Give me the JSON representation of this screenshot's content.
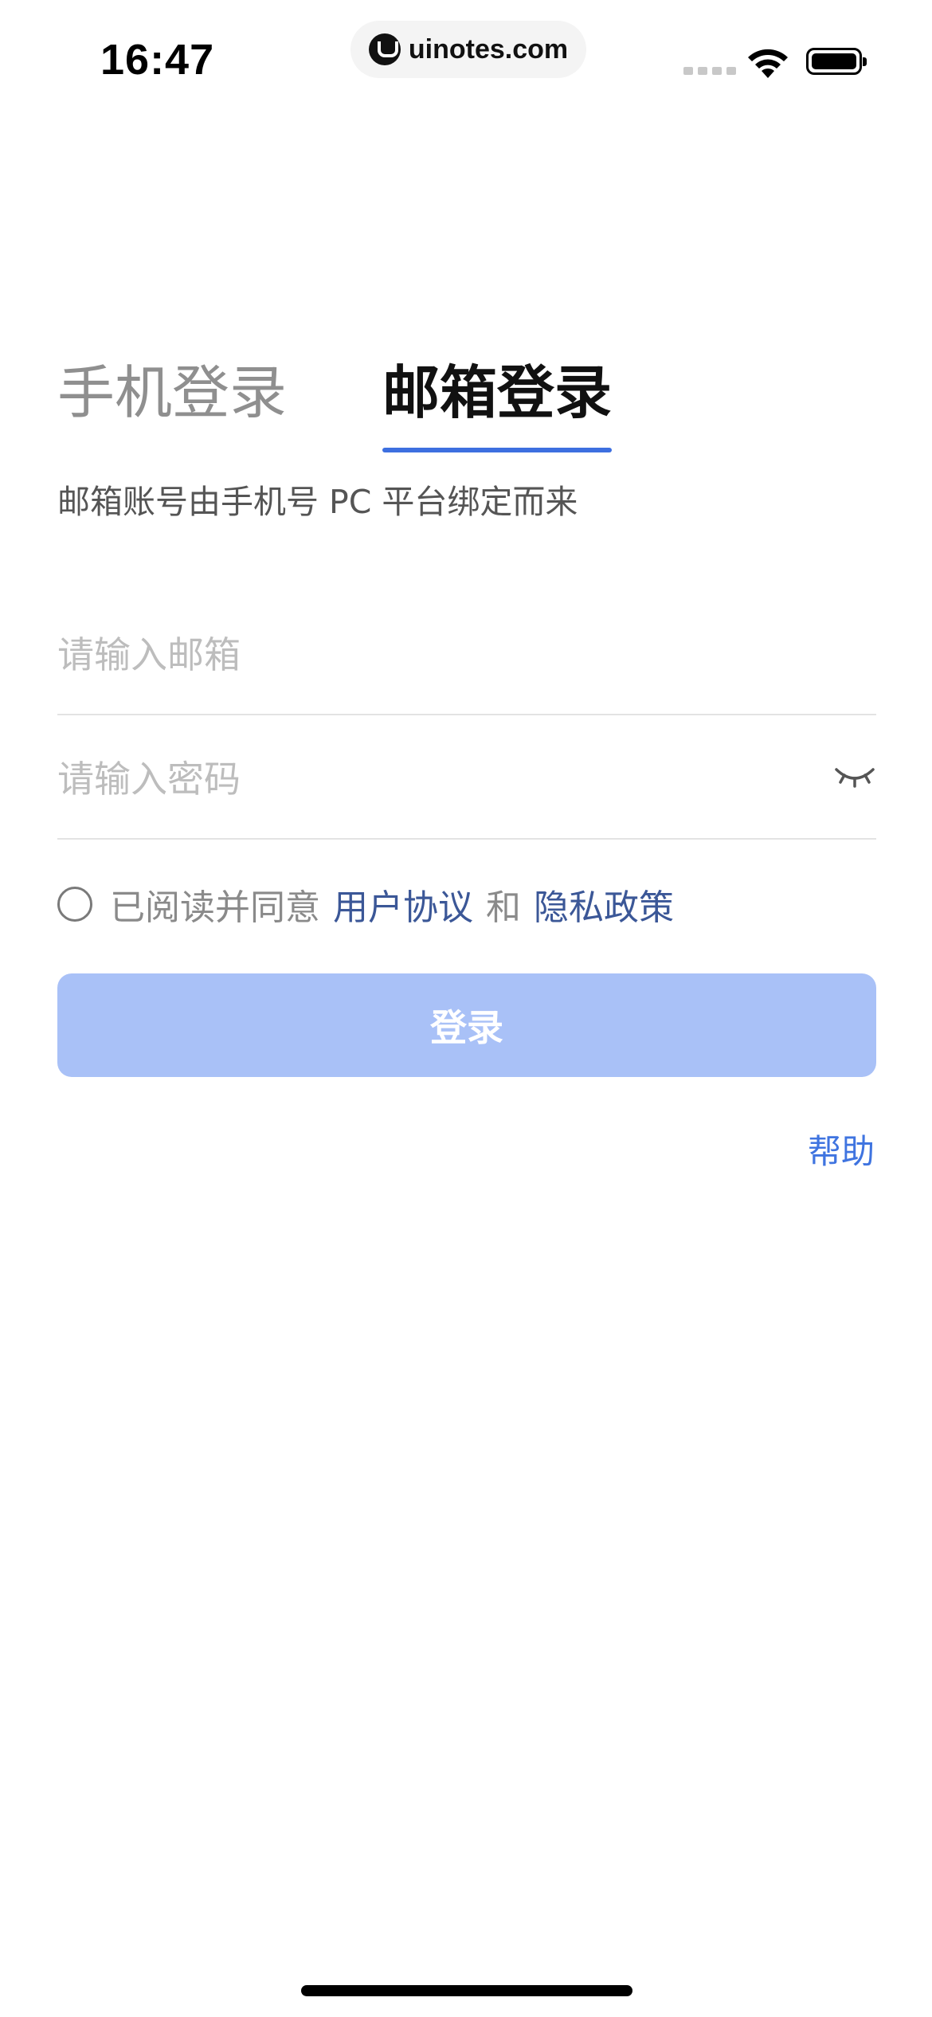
{
  "status_bar": {
    "time": "16:47",
    "url": "uinotes.com"
  },
  "tabs": [
    {
      "label": "手机登录",
      "active": false
    },
    {
      "label": "邮箱登录",
      "active": true
    }
  ],
  "subtitle": "邮箱账号由手机号 PC 平台绑定而来",
  "form": {
    "email_placeholder": "请输入邮箱",
    "email_value": "",
    "password_placeholder": "请输入密码",
    "password_value": ""
  },
  "agreement": {
    "prefix": "已阅读并同意",
    "terms_link": "用户协议",
    "conjunction": "和",
    "privacy_link": "隐私政策",
    "checked": false
  },
  "login_button": "登录",
  "help_link": "帮助",
  "colors": {
    "accent": "#3d6fe0",
    "button_disabled": "#a9c1f7",
    "link": "#3b5797",
    "help": "#3f74e0"
  },
  "icons": {
    "password_toggle": "eye-closed-icon",
    "url_logo": "uinotes-logo-icon"
  }
}
